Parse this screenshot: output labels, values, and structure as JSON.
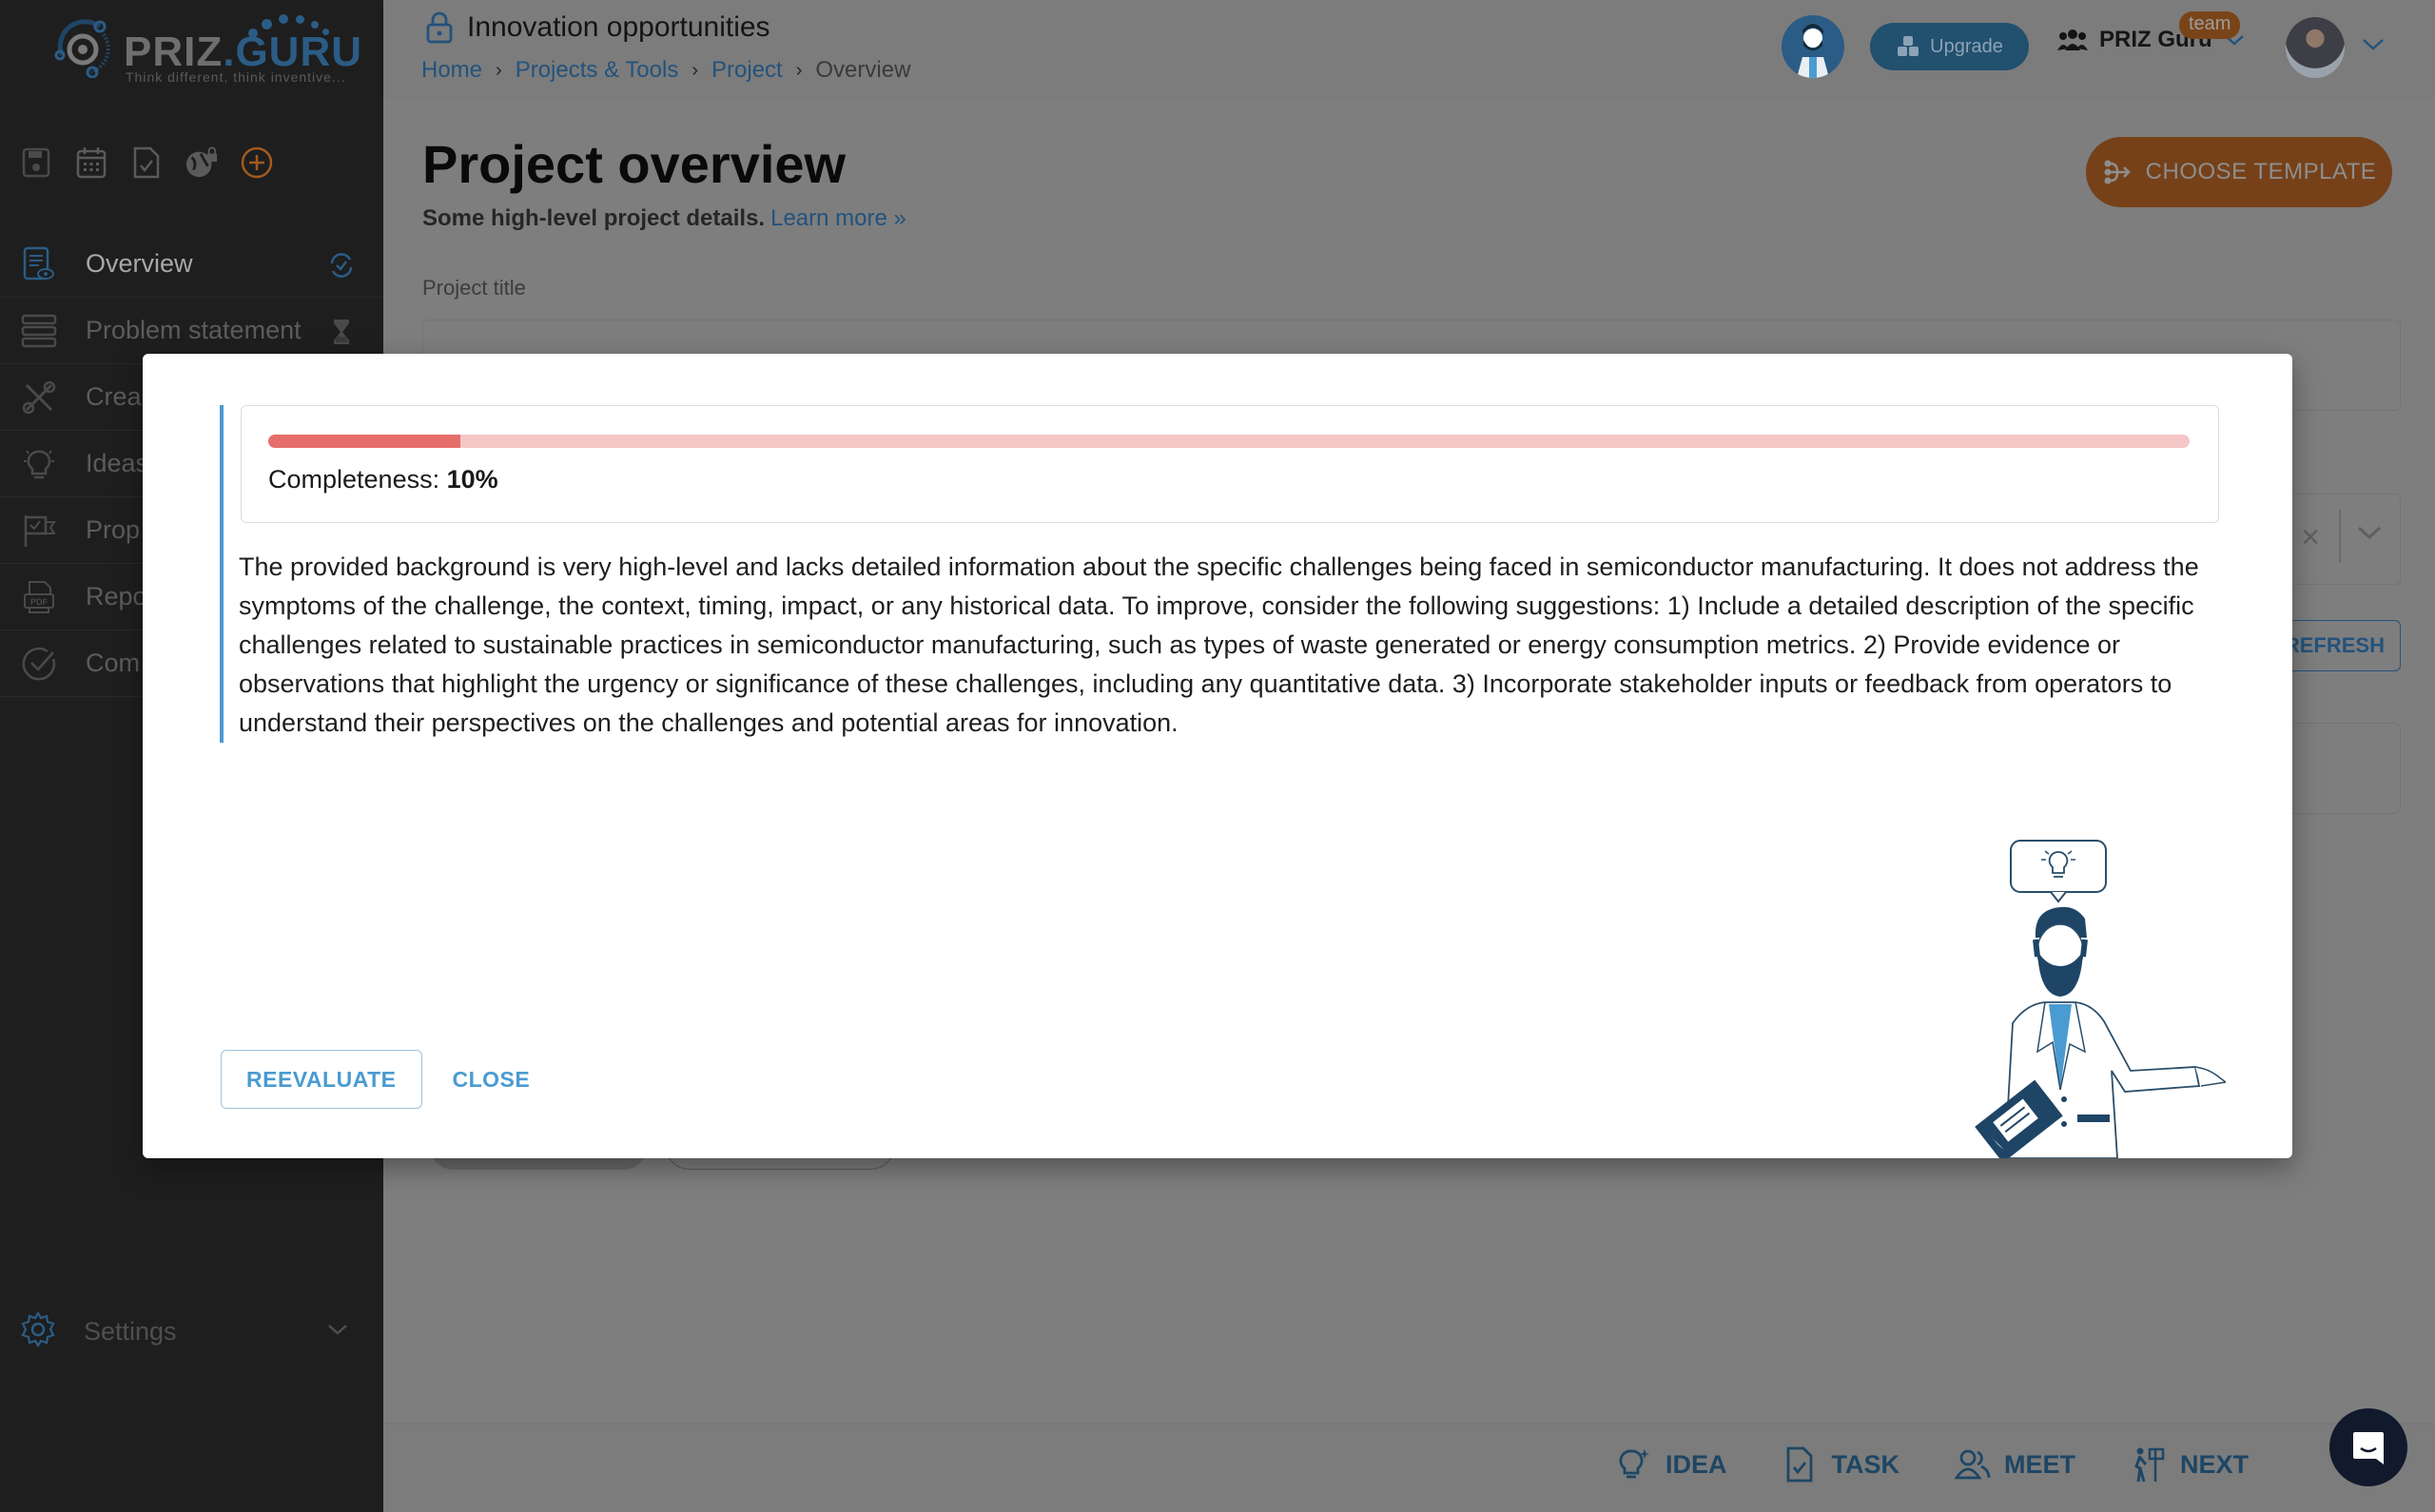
{
  "app": {
    "brand_name_part1": "PRIZ",
    "brand_name_part2": ".GURU",
    "tagline": "Think different, think inventive...",
    "accent_color": "#4a9bd1",
    "brand_orange": "#e07b2e"
  },
  "sidebar": {
    "quick_icons": [
      "save-icon",
      "calendar-icon",
      "file-check-icon",
      "globe-lock-icon",
      "add-circle-icon"
    ],
    "items": [
      {
        "label": "Overview",
        "icon": "document-eye-icon",
        "status_icon": "sync-check-icon",
        "active": true
      },
      {
        "label": "Problem statement",
        "icon": "list-stack-icon",
        "status_icon": "hourglass-icon",
        "active": false
      },
      {
        "label": "Crea",
        "icon": "tools-icon",
        "active": false
      },
      {
        "label": "Ideas",
        "icon": "lightbulb-icon",
        "active": false
      },
      {
        "label": "Prop",
        "icon": "flag-check-icon",
        "active": false
      },
      {
        "label": "Repo",
        "icon": "pdf-icon",
        "active": false
      },
      {
        "label": "Com",
        "icon": "check-circle-icon",
        "active": false
      }
    ],
    "settings_label": "Settings"
  },
  "header": {
    "project_title": "Innovation opportunities",
    "breadcrumb": [
      {
        "label": "Home",
        "link": true
      },
      {
        "label": "Projects & Tools",
        "link": true
      },
      {
        "label": "Project",
        "link": true
      },
      {
        "label": "Overview",
        "link": false
      }
    ],
    "upgrade_label": "Upgrade",
    "team_name": "PRIZ Guru",
    "team_badge": "team"
  },
  "page": {
    "title": "Project overview",
    "subtitle": "Some high-level project details.",
    "learn_more": "Learn more »",
    "choose_template_label": "CHOOSE TEMPLATE",
    "project_title_label": "Project title",
    "project_title_value": "",
    "refresh_label": "REFRESH"
  },
  "bottom_bar": {
    "actions": [
      {
        "label": "IDEA",
        "icon": "lightbulb-icon"
      },
      {
        "label": "TASK",
        "icon": "task-file-icon"
      },
      {
        "label": "MEET",
        "icon": "people-icon"
      },
      {
        "label": "NEXT",
        "icon": "walking-sign-icon"
      }
    ]
  },
  "modal": {
    "completeness_label": "Completeness:",
    "completeness_value": "10%",
    "completeness_fraction": 0.1,
    "feedback": "The provided background is very high-level and lacks detailed information about the specific challenges being faced in semiconductor manufacturing. It does not address the symptoms of the challenge, the context, timing, impact, or any historical data. To improve, consider the following suggestions: 1) Include a detailed description of the specific challenges related to sustainable practices in semiconductor manufacturing, such as types of waste generated or energy consumption metrics. 2) Provide evidence or observations that highlight the urgency or significance of these challenges, including any quantitative data. 3) Incorporate stakeholder inputs or feedback from operators to understand their perspectives on the challenges and potential areas for innovation.",
    "reevaluate_label": "REEVALUATE",
    "close_label": "CLOSE"
  }
}
